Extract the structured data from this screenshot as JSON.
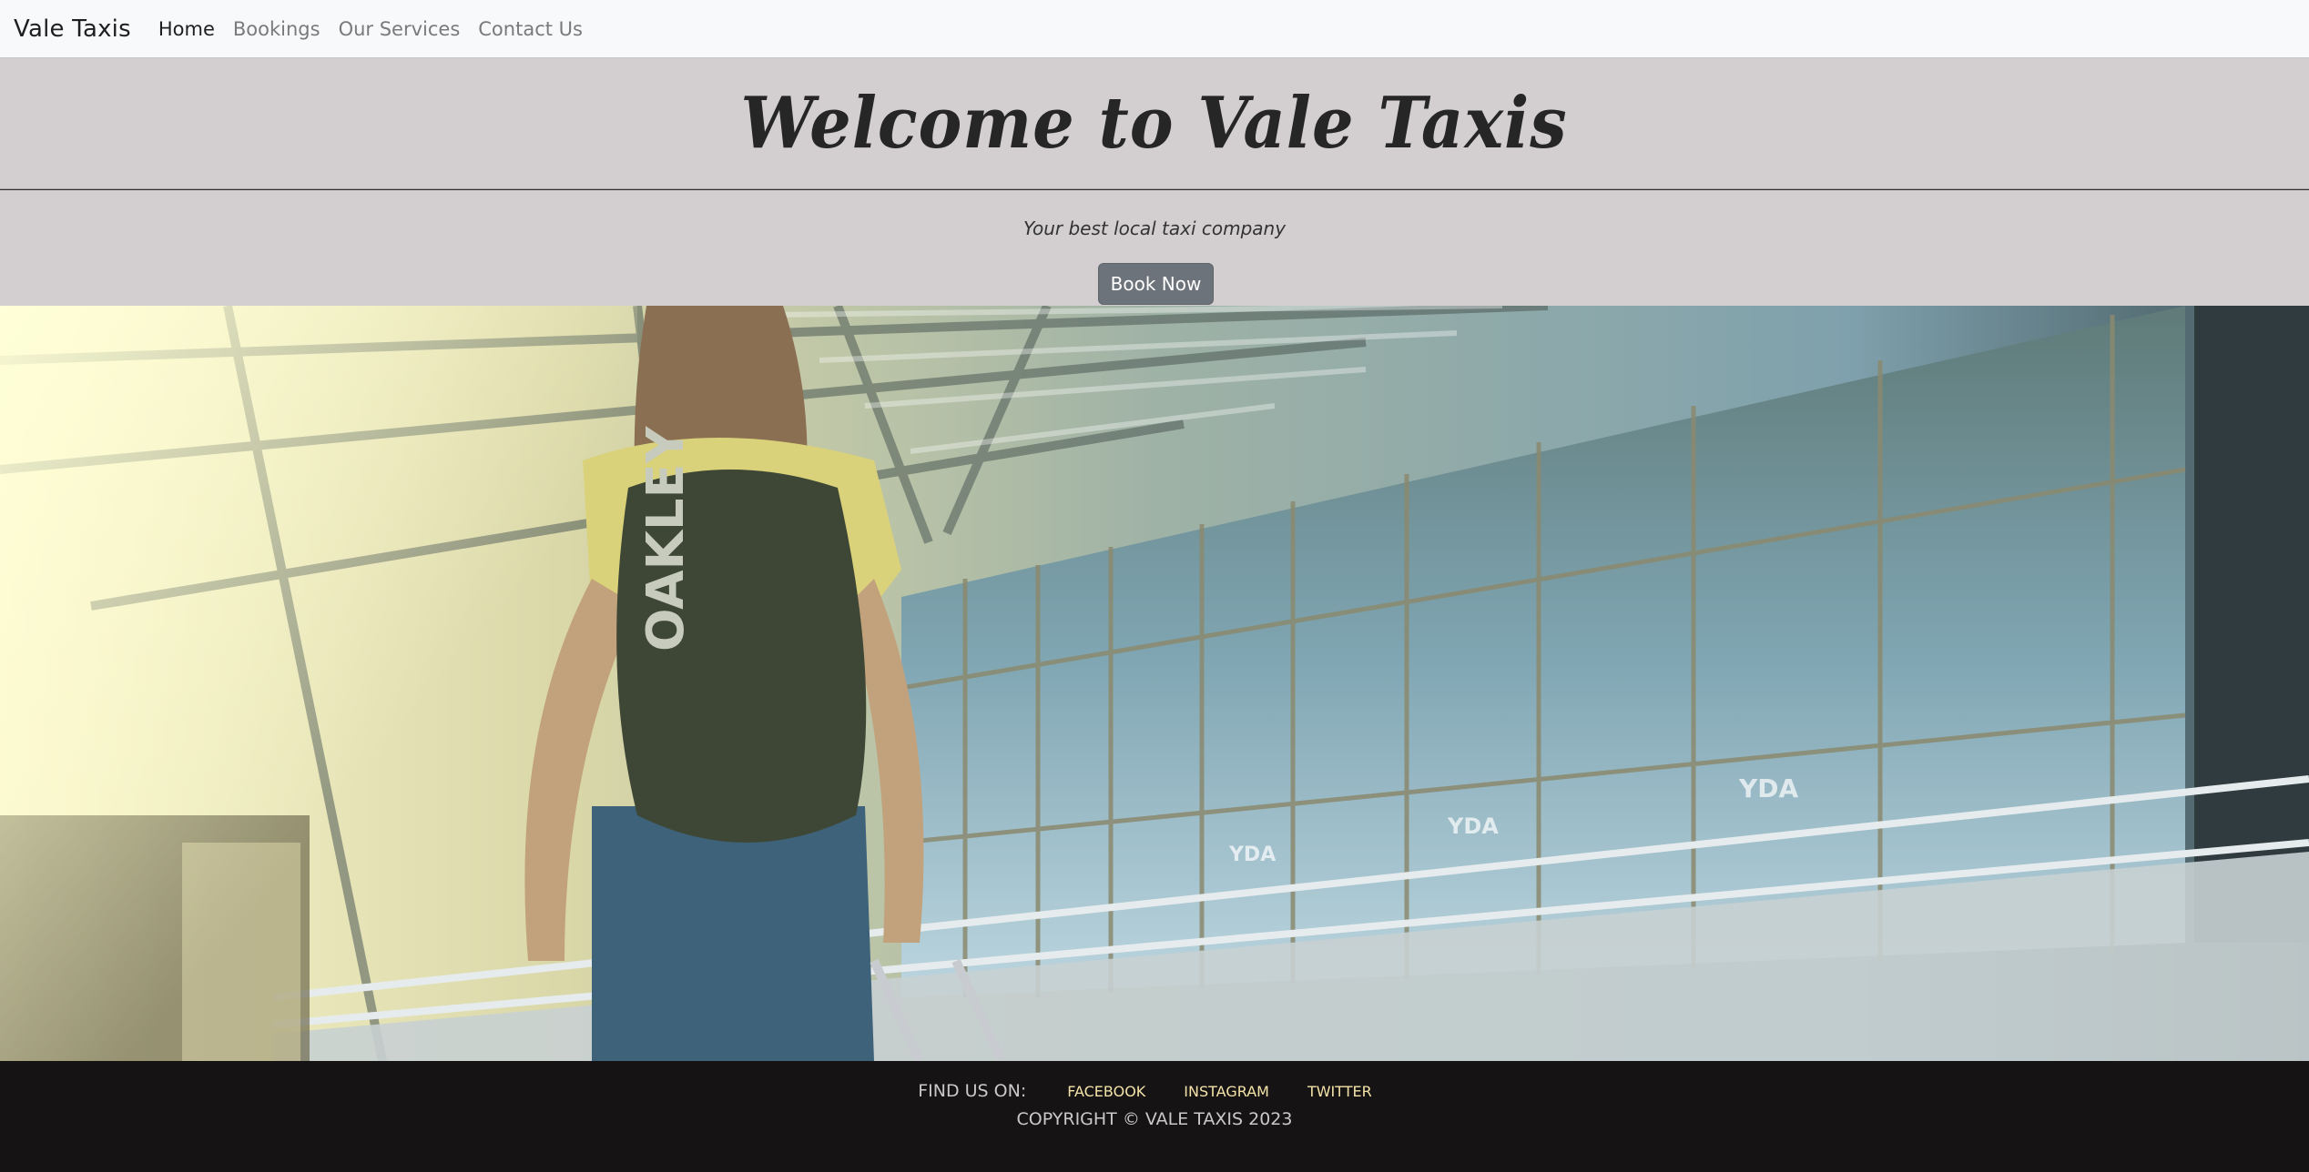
{
  "navbar": {
    "brand": "Vale Taxis",
    "links": [
      {
        "label": "Home",
        "active": true
      },
      {
        "label": "Bookings",
        "active": false
      },
      {
        "label": "Our Services",
        "active": false
      },
      {
        "label": "Contact Us",
        "active": false
      }
    ]
  },
  "header": {
    "title": "Welcome to Vale Taxis",
    "tagline": "Your best local taxi company",
    "book_button": "Book Now"
  },
  "hero": {
    "image": "traveler-with-backpack-airport-terminal",
    "backpack_text": "OAKLEY",
    "signage_text": "YDA"
  },
  "footer": {
    "find_label": "FIND US ON:",
    "social": [
      "FACEBOOK",
      "INSTAGRAM",
      "TWITTER"
    ],
    "copyright": "COPYRIGHT © VALE TAXIS 2023"
  },
  "colors": {
    "navbar_bg": "#f8f9fb",
    "header_bg": "#d3cfd0",
    "button_bg": "#6d737a",
    "footer_bg": "#161314",
    "social_link": "#f3e3a8"
  }
}
